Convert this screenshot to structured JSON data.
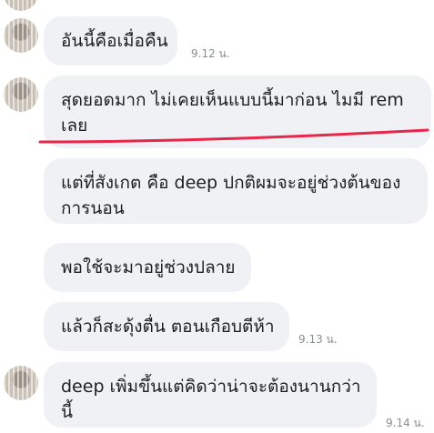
{
  "messages": [
    {
      "text_lines": [
        "อันนี้คือเมื่อคืน"
      ],
      "time": "9.12 น."
    },
    {
      "text_lines": [
        "สุดยอดมาก ไม่เคยเห็นแบบนี้มาก่อน ไมมี rem",
        "เลย"
      ]
    },
    {
      "text_lines": [
        "แต่ที่สังเกต คือ deep ปกติผมจะอยู่ช่วงต้นของ",
        "การนอน"
      ]
    },
    {
      "text_lines": [
        "พอใช้จะมาอยู่ช่วงปลาย"
      ]
    },
    {
      "text_lines": [
        "แล้วก็สะดุ้งตื่น ตอนเกือบตีห้า"
      ],
      "time": "9.13 น."
    },
    {
      "text_lines": [
        "deep เพิ่มขึ้นแต่คิดว่าน่าจะต้องนานกว่า",
        "นี้"
      ],
      "time": "9.14 น."
    }
  ],
  "colors": {
    "bubble": "#f0f1f4",
    "underline": "#e8264c",
    "time": "#8a8d91"
  },
  "icons": {
    "avatar": "avatar-icon"
  }
}
